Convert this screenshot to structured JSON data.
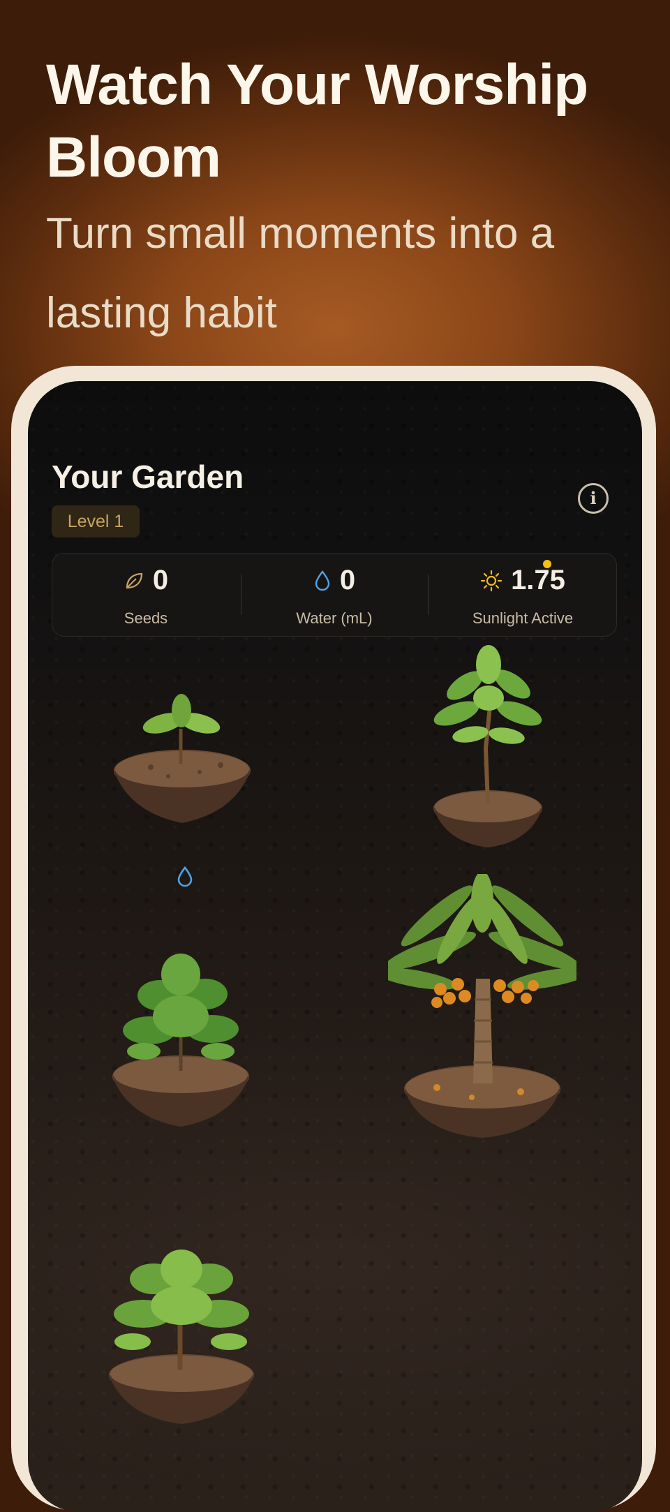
{
  "header": {
    "title": "Watch Your Worship Bloom",
    "subtitle": "Turn small moments into a lasting habit"
  },
  "garden": {
    "title": "Your Garden",
    "level_badge": "Level 1",
    "info_icon": "info-icon"
  },
  "stats": [
    {
      "icon": "leaf-icon",
      "value": "0",
      "label": "Seeds"
    },
    {
      "icon": "water-drop-icon",
      "value": "0",
      "label": "Water (mL)"
    },
    {
      "icon": "sun-icon",
      "value": "1.75",
      "label": "Sunlight Active"
    }
  ],
  "colors": {
    "accent_gold": "#c7a463",
    "water_blue": "#4fa3e6",
    "sun_yellow": "#f4bd18",
    "status_dot": "#f4bd18",
    "headline": "#fdf6ea"
  },
  "plants": [
    {
      "kind": "sprout"
    },
    {
      "kind": "sapling"
    },
    {
      "kind": "bush"
    },
    {
      "kind": "date-palm"
    },
    {
      "kind": "young-tree"
    }
  ]
}
